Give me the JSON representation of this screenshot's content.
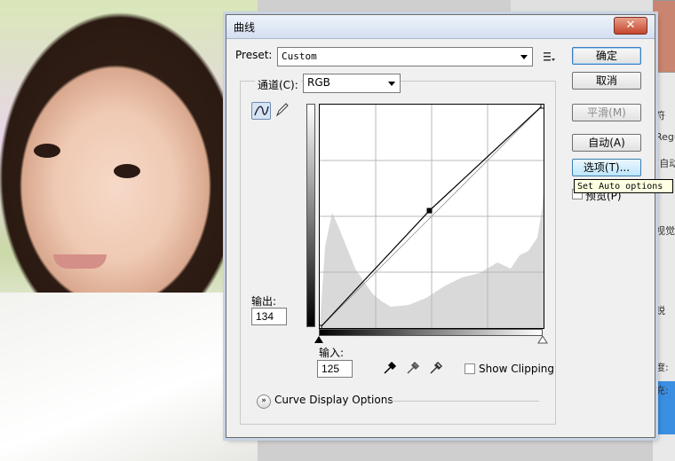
{
  "dialog": {
    "title": "曲线",
    "close_label": "✕"
  },
  "preset": {
    "label": "Preset:",
    "value": "Custom"
  },
  "channel": {
    "label": "通道(C):",
    "value": "RGB"
  },
  "buttons": {
    "ok": "确定",
    "cancel": "取消",
    "smooth": "平滑(M)",
    "auto": "自动(A)",
    "options": "选项(T)..."
  },
  "tooltip": "Set Auto options",
  "preview_label": "预览(P)",
  "output": {
    "label": "输出:",
    "value": "134"
  },
  "input": {
    "label": "输入:",
    "value": "125"
  },
  "show_clipping_label": "Show Clipping",
  "curve_display_label": "Curve Display Options",
  "icons": {
    "curve_tool": "curve-tool-icon",
    "pencil_tool": "pencil-icon",
    "preset_menu": "preset-menu-icon",
    "eyedropper": "eyedropper-icon"
  },
  "right_panel_text": [
    "符",
    "Regul",
    "(自动",
    "视觉",
    "锐",
    "度:",
    "充:"
  ],
  "chart_data": {
    "type": "line",
    "x": [
      0,
      125,
      255
    ],
    "y": [
      0,
      134,
      255
    ],
    "xlim": [
      0,
      255
    ],
    "ylim": [
      0,
      255
    ],
    "grid": true,
    "control_point": [
      125,
      134
    ]
  },
  "colors": {
    "accent": "#3b7fc4",
    "histogram": "#d9d9d9"
  }
}
